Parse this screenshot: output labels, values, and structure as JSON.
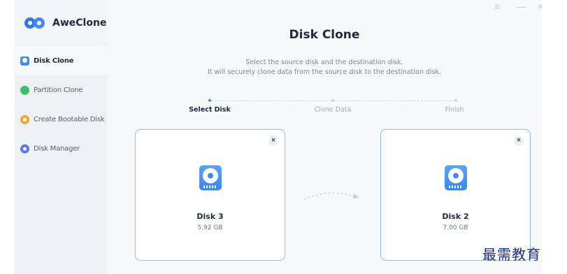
{
  "app": {
    "name": "AweClone"
  },
  "sidebar": {
    "items": [
      {
        "label": "Disk Clone",
        "icon": "disk-clone-icon",
        "active": true
      },
      {
        "label": "Partition Clone",
        "icon": "partition-clone-icon",
        "active": false
      },
      {
        "label": "Create Bootable Disk",
        "icon": "bootable-disk-icon",
        "active": false
      },
      {
        "label": "Disk Manager",
        "icon": "disk-manager-icon",
        "active": false
      }
    ]
  },
  "window_controls": {
    "menu": "≡",
    "minimize": "—",
    "close": "×"
  },
  "main": {
    "title": "Disk Clone",
    "subtitle_line1": "Select the source disk and the destination disk.",
    "subtitle_line2": "It will securely clone data from the source disk to the destination disk.",
    "steps": [
      {
        "label": "Select Disk",
        "active": true
      },
      {
        "label": "Clone Data",
        "active": false
      },
      {
        "label": "Finish",
        "active": false
      }
    ],
    "source_disk": {
      "name": "Disk 3",
      "size": "5.92 GB",
      "close": "×"
    },
    "destination_disk": {
      "name": "Disk 2",
      "size": "7.00 GB",
      "close": "×"
    }
  },
  "colors": {
    "accent": "#3e8cf2",
    "card_border": "#8fbaf5",
    "sidebar_bg": "#eef0f4"
  },
  "watermark": "最需教育"
}
